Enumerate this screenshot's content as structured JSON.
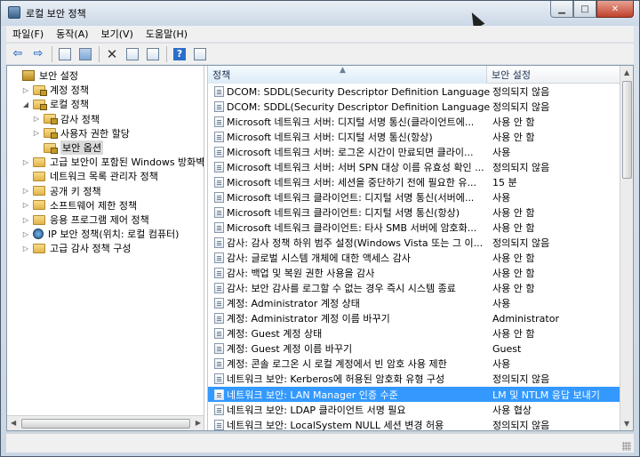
{
  "window": {
    "title": "로컬 보안 정책"
  },
  "menu": [
    "파일(F)",
    "동작(A)",
    "보기(V)",
    "도움말(H)"
  ],
  "tree": [
    {
      "label": "보안 설정",
      "icon": "security-settings-icon",
      "indent": 0,
      "expander": ""
    },
    {
      "label": "계정 정책",
      "icon": "folder-lock-icon",
      "indent": 1,
      "expander": "▷"
    },
    {
      "label": "로컬 정책",
      "icon": "folder-lock-icon",
      "indent": 1,
      "expander": "◢"
    },
    {
      "label": "감사 정책",
      "icon": "folder-lock-icon",
      "indent": 2,
      "expander": "▷"
    },
    {
      "label": "사용자 권한 할당",
      "icon": "folder-lock-icon",
      "indent": 2,
      "expander": "▷"
    },
    {
      "label": "보안 옵션",
      "icon": "folder-lock-icon",
      "indent": 2,
      "expander": "",
      "selected": true
    },
    {
      "label": "고급 보안이 포함된 Windows 방화벽",
      "icon": "folder-icon",
      "indent": 1,
      "expander": "▷"
    },
    {
      "label": "네트워크 목록 관리자 정책",
      "icon": "folder-icon",
      "indent": 1,
      "expander": ""
    },
    {
      "label": "공개 키 정책",
      "icon": "folder-icon",
      "indent": 1,
      "expander": "▷"
    },
    {
      "label": "소프트웨어 제한 정책",
      "icon": "folder-icon",
      "indent": 1,
      "expander": "▷"
    },
    {
      "label": "응용 프로그램 제어 정책",
      "icon": "folder-icon",
      "indent": 1,
      "expander": "▷"
    },
    {
      "label": "IP 보안 정책(위치: 로컬 컴퓨터)",
      "icon": "ip-security-icon",
      "indent": 1,
      "expander": "▷"
    },
    {
      "label": "고급 감사 정책 구성",
      "icon": "folder-icon",
      "indent": 1,
      "expander": "▷"
    }
  ],
  "columns": {
    "policy": "정책",
    "setting": "보안 설정"
  },
  "rows": [
    {
      "policy": "DCOM: SDDL(Security Descriptor Definition Language) 구...",
      "setting": "정의되지 않음"
    },
    {
      "policy": "DCOM: SDDL(Security Descriptor Definition Language) 구...",
      "setting": "정의되지 않음"
    },
    {
      "policy": "Microsoft 네트워크 서버: 디지털 서명 통신(클라이언트에...",
      "setting": "사용 안 함"
    },
    {
      "policy": "Microsoft 네트워크 서버: 디지털 서명 통신(항상)",
      "setting": "사용 안 함"
    },
    {
      "policy": "Microsoft 네트워크 서버: 로그온 시간이 만료되면 클라이...",
      "setting": "사용"
    },
    {
      "policy": "Microsoft 네트워크 서버: 서버 SPN 대상 이름 유효성 확인 ...",
      "setting": "정의되지 않음"
    },
    {
      "policy": "Microsoft 네트워크 서버: 세션을 중단하기 전에 필요한 유...",
      "setting": "15 분"
    },
    {
      "policy": "Microsoft 네트워크 클라이언트: 디지털 서명 통신(서버에...",
      "setting": "사용"
    },
    {
      "policy": "Microsoft 네트워크 클라이언트: 디지털 서명 통신(항상)",
      "setting": "사용 안 함"
    },
    {
      "policy": "Microsoft 네트워크 클라이언트: 타사 SMB 서버에 암호화...",
      "setting": "사용 안 함"
    },
    {
      "policy": "감사: 감사 정책 하위 범주 설정(Windows Vista 또는 그 이...",
      "setting": "정의되지 않음"
    },
    {
      "policy": "감사: 글로벌 시스템 개체에 대한 액세스 감사",
      "setting": "사용 안 함"
    },
    {
      "policy": "감사: 백업 및 복원 권한 사용을 감사",
      "setting": "사용 안 함"
    },
    {
      "policy": "감사: 보안 감사를 로그할 수 없는 경우 즉시 시스템 종료",
      "setting": "사용 안 함"
    },
    {
      "policy": "계정: Administrator 계정 상태",
      "setting": "사용"
    },
    {
      "policy": "계정: Administrator 계정 이름 바꾸기",
      "setting": "Administrator"
    },
    {
      "policy": "계정: Guest 계정 상태",
      "setting": "사용 안 함"
    },
    {
      "policy": "계정: Guest 계정 이름 바꾸기",
      "setting": "Guest"
    },
    {
      "policy": "계정: 콘솔 로그온 시 로컬 계정에서 빈 암호 사용 제한",
      "setting": "사용"
    },
    {
      "policy": "네트워크 보안: Kerberos에 허용된 암호화 유형 구성",
      "setting": "정의되지 않음"
    },
    {
      "policy": "네트워크 보안: LAN Manager 인증 수준",
      "setting": "LM 및 NTLM 응답 보내기",
      "selected": true
    },
    {
      "policy": "네트워크 보안: LDAP 클라이언트 서명 필요",
      "setting": "사용 협상"
    },
    {
      "policy": "네트워크 보안: LocalSystem NULL 세션 변경 허용",
      "setting": "정의되지 않음"
    }
  ]
}
